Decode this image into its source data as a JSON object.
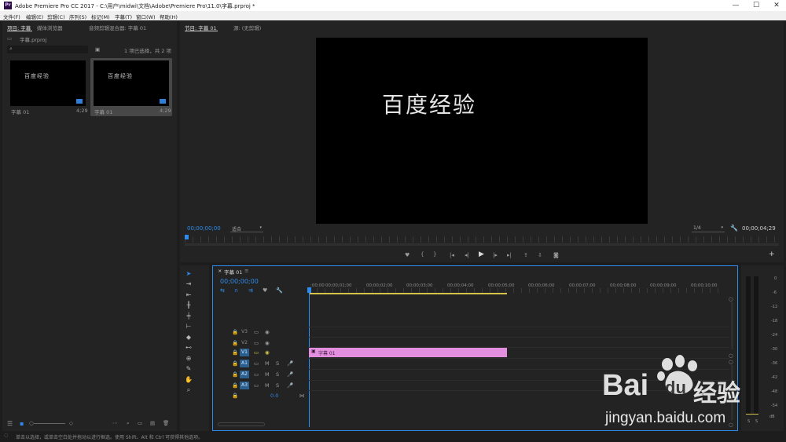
{
  "window": {
    "title": "Adobe Premiere Pro CC 2017 - C:\\用户\\midwi\\文档\\Adobe\\Premiere Pro\\11.0\\字幕.prproj *",
    "logo": "Pr",
    "minimize": "—",
    "maximize": "☐",
    "close": "✕"
  },
  "menu": [
    "文件(F)",
    "编辑(E)",
    "剪辑(C)",
    "序列(S)",
    "标记(M)",
    "字幕(T)",
    "窗口(W)",
    "帮助(H)"
  ],
  "project": {
    "tab_project": "项目: 字幕",
    "tab_media": "媒体浏览器",
    "tab_audio": "音频剪辑混合器: 字幕 01",
    "filename": "字幕.prproj",
    "selection_info": "1 项已选择，共 2 项",
    "items": [
      {
        "thumb_text": "百度经验",
        "name": "字幕 01",
        "duration": "4;29"
      },
      {
        "thumb_text": "百度经验",
        "name": "字幕 01",
        "duration": "4;29"
      }
    ]
  },
  "program": {
    "tab_program": "节目: 字幕 01",
    "tab_source": "源: (无剪辑)",
    "video_text": "百度经验",
    "timecode_current": "00;00;00;00",
    "fit": "适合",
    "resolution": "1/4",
    "timecode_total": "00;00;04;29"
  },
  "timeline": {
    "tab": "字幕 01",
    "timecode": "00;00;00;00",
    "ruler": [
      ":00;00",
      "00;00;01;00",
      "00;00;02;00",
      "00;00;03;00",
      "00;00;04;00",
      "00;00;05;00",
      "00;00;06;00",
      "00;00;07;00",
      "00;00;08;00",
      "00;00;09;00",
      "00;00;10;00"
    ],
    "video_tracks": [
      "V3",
      "V2",
      "V1"
    ],
    "audio_tracks": [
      "A1",
      "A2",
      "A3"
    ],
    "master_value": "0.0",
    "clip_label": "字幕 01",
    "m_label": "M",
    "s_label": "S"
  },
  "meters": {
    "scale": [
      "0",
      "-6",
      "-12",
      "-18",
      "-24",
      "-30",
      "-36",
      "-42",
      "-48",
      "-54",
      "dB"
    ],
    "solo_left": "S",
    "solo_right": "S"
  },
  "status": {
    "text": "单击以选择，或单击空白处并拖动以进行框选。使用 Shift、Alt 和 Ctrl 可获得其他选项。"
  },
  "watermark": {
    "brand": "Bai",
    "brand2": "du",
    "cn": "经验",
    "url": "jingyan.baidu.com"
  },
  "colors": {
    "accent": "#2d8ceb",
    "clip": "#e48ee0",
    "background": "#1d1d1d",
    "panel": "#232323"
  }
}
